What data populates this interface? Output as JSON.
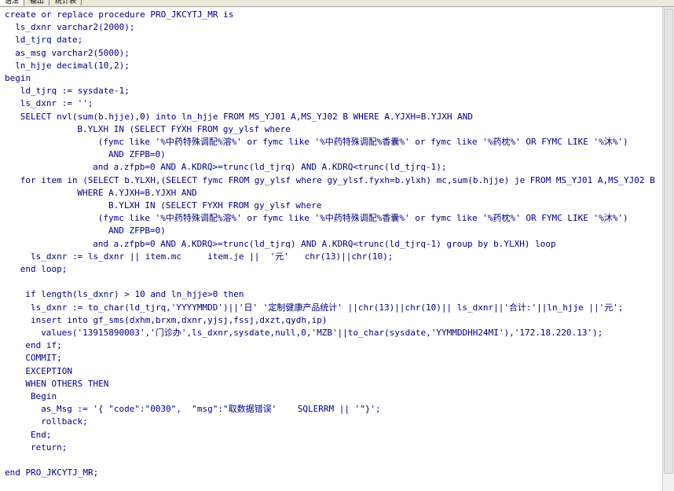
{
  "tabs": [
    {
      "label": "语法"
    },
    {
      "label": "输出"
    },
    {
      "label": "统计表"
    }
  ],
  "code": {
    "lines": [
      {
        "text": "create or replace procedure PRO_JKCYTJ_MR is",
        "indent": 0,
        "y": 0
      },
      {
        "text": "ls_dxnr varchar2(2000);",
        "indent": 2,
        "y": 1
      },
      {
        "text": "ld_tjrq date;",
        "indent": 2,
        "y": 2
      },
      {
        "text": "as_msg varchar2(5000);",
        "indent": 2,
        "y": 3
      },
      {
        "text": "ln_hjje decimal(10,2);",
        "indent": 2,
        "y": 4
      },
      {
        "text": "begin",
        "indent": 0,
        "y": 5
      },
      {
        "text": "ld_tjrq := sysdate-1;",
        "indent": 3,
        "y": 6
      },
      {
        "text": "ls_dxnr := '';",
        "indent": 3,
        "y": 7
      },
      {
        "text": "SELECT nvl(sum(b.hjje),0) into ln_hjje FROM MS_YJ01 A,MS_YJ02 B WHERE A.YJXH=B.YJXH AND",
        "indent": 3,
        "y": 8
      },
      {
        "text": "B.YLXH IN (SELECT FYXH FROM gy_ylsf where",
        "indent": 14,
        "y": 9
      },
      {
        "text": "(fymc like '%中药特殊调配%溶%' or fymc like '%中药特殊调配%香囊%' or fymc like '%药枕%' OR FYMC LIKE '%沐%')",
        "indent": 18,
        "y": 10
      },
      {
        "text": "AND ZFPB=0)",
        "indent": 20,
        "y": 11
      },
      {
        "text": "and a.zfpb=0 AND A.KDRQ>=trunc(ld_tjrq) AND A.KDRQ<trunc(ld_tjrq-1);",
        "indent": 17,
        "y": 12
      },
      {
        "text": "for item in (SELECT b.YLXH,(SELECT fymc FROM gy_ylsf where gy_ylsf.fyxh=b.ylxh) mc,sum(b.hjje) je FROM MS_YJ01 A,MS_YJ02 B",
        "indent": 3,
        "y": 13
      },
      {
        "text": "WHERE A.YJXH=B.YJXH AND",
        "indent": 14,
        "y": 14
      },
      {
        "text": "B.YLXH IN (SELECT FYXH FROM gy_ylsf where",
        "indent": 20,
        "y": 15
      },
      {
        "text": "(fymc like '%中药特殊调配%溶%' or fymc like '%中药特殊调配%香囊%' or fymc like '%药枕%' OR FYMC LIKE '%沐%')",
        "indent": 18,
        "y": 16
      },
      {
        "text": "AND ZFPB=0)",
        "indent": 20,
        "y": 17
      },
      {
        "text": "and a.zfpb=0 AND A.KDRQ>=trunc(ld_tjrq) AND A.KDRQ<trunc(ld_tjrq-1) group by b.YLXH) loop",
        "indent": 17,
        "y": 18
      },
      {
        "text": "ls_dxnr := ls_dxnr || item.mc     item.je ||  '元'   chr(13)||chr(10);",
        "indent": 5,
        "y": 19
      },
      {
        "text": "end loop;",
        "indent": 3,
        "y": 20
      },
      {
        "text": "",
        "indent": 0,
        "y": 21
      },
      {
        "text": "if length(ls_dxnr) > 10 and ln_hjje>0 then",
        "indent": 4,
        "y": 22
      },
      {
        "text": "ls_dxnr := to_char(ld_tjrq,'YYYYMMDD')||'日' '定制健康产品统计' ||chr(13)||chr(10)|| ls_dxnr||'合计:'||ln_hjje ||'元';",
        "indent": 5,
        "y": 23
      },
      {
        "text": "insert into gf_sms(dxhm,brxm,dxnr,yjsj,fssj,dxzt,qydh,ip)",
        "indent": 5,
        "y": 24
      },
      {
        "text": "values('13915890003','门诊办',ls_dxnr,sysdate,null,0,'MZB'||to_char(sysdate,'YYMMDDHH24MI'),'172.18.220.13');",
        "indent": 7,
        "y": 25
      },
      {
        "text": "end if;",
        "indent": 4,
        "y": 26
      },
      {
        "text": "COMMIT;",
        "indent": 4,
        "y": 27
      },
      {
        "text": "EXCEPTION",
        "indent": 4,
        "y": 28
      },
      {
        "text": "WHEN OTHERS THEN",
        "indent": 4,
        "y": 29
      },
      {
        "text": "Begin",
        "indent": 5,
        "y": 30
      },
      {
        "text": "as_Msg := '{ \"code\":\"0030\",  \"msg\":\"取数据错误'    SQLERRM || '\"}';",
        "indent": 7,
        "y": 31
      },
      {
        "text": "rollback;",
        "indent": 7,
        "y": 32
      },
      {
        "text": "End;",
        "indent": 5,
        "y": 33
      },
      {
        "text": "return;",
        "indent": 5,
        "y": 34
      },
      {
        "text": "",
        "indent": 0,
        "y": 35
      },
      {
        "text": "end PRO_JKCYTJ_MR;",
        "indent": 0,
        "y": 36
      }
    ]
  }
}
